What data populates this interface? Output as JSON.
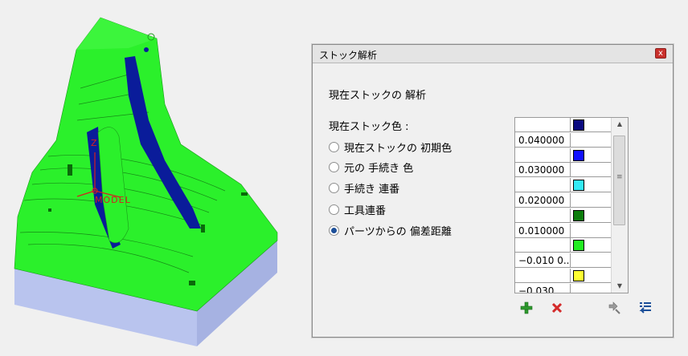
{
  "dialog": {
    "title": "ストック解析",
    "close_glyph": "x",
    "section_title": "現在ストックの 解析",
    "color_label": "現在ストック色 :",
    "options": [
      {
        "label": "現在ストックの 初期色",
        "checked": false
      },
      {
        "label": "元の 手続き 色",
        "checked": false
      },
      {
        "label": "手続き 連番",
        "checked": false
      },
      {
        "label": "工具連番",
        "checked": false
      },
      {
        "label": "パーツからの 偏差距離",
        "checked": true
      }
    ],
    "scale_rows": [
      {
        "value": "",
        "color": "#0a0a80"
      },
      {
        "value": "0.040000",
        "color": ""
      },
      {
        "value": "",
        "color": "#1010ff"
      },
      {
        "value": "0.030000",
        "color": ""
      },
      {
        "value": "",
        "color": "#33eaf5"
      },
      {
        "value": "0.020000",
        "color": ""
      },
      {
        "value": "",
        "color": "#0b7d0b"
      },
      {
        "value": "0.010000",
        "color": ""
      },
      {
        "value": "",
        "color": "#22ee22"
      },
      {
        "value": "−0.010 0...",
        "color": ""
      },
      {
        "value": "",
        "color": "#ffff33"
      },
      {
        "value": "−0.030",
        "color": ""
      }
    ],
    "tools": {
      "add_icon": "plus-icon",
      "delete_icon": "delete-x-icon",
      "apply_icon": "apply-arrow-icon",
      "settings_icon": "list-settings-icon"
    }
  },
  "viewport": {
    "axis_z": "Z",
    "axis_label": "MODEL",
    "colors": {
      "surface_green": "#2bf02b",
      "deviation_blue": "#0a1c9a",
      "stock_base": "#b9c4ee"
    }
  }
}
